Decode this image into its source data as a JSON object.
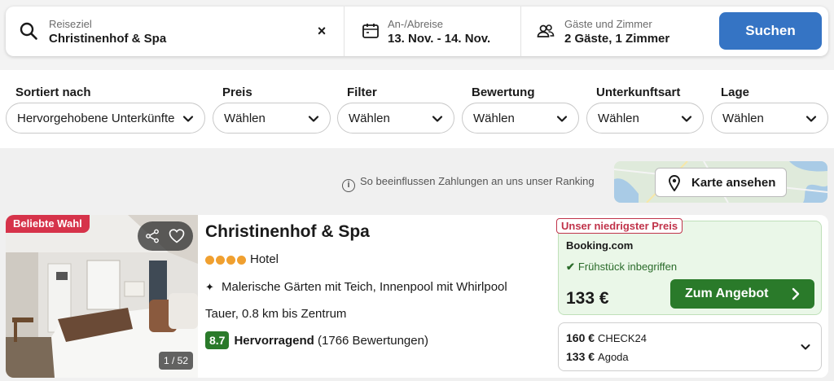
{
  "search": {
    "destination_label": "Reiseziel",
    "destination_value": "Christinenhof & Spa",
    "clear_symbol": "×",
    "dates_label": "An-/Abreise",
    "dates_value": "13. Nov. - 14. Nov.",
    "guests_label": "Gäste und Zimmer",
    "guests_value": "2 Gäste, 1 Zimmer",
    "search_button": "Suchen",
    "accent_color": "#3574c4"
  },
  "filters": [
    {
      "label": "Sortiert nach",
      "value": "Hervorgehobene Unterkünfte"
    },
    {
      "label": "Preis",
      "value": "Wählen"
    },
    {
      "label": "Filter",
      "value": "Wählen"
    },
    {
      "label": "Bewertung",
      "value": "Wählen"
    },
    {
      "label": "Unterkunftsart",
      "value": "Wählen"
    },
    {
      "label": "Lage",
      "value": "Wählen"
    }
  ],
  "ranking": {
    "info_symbol": "i",
    "text": "So beeinflussen Zahlungen an uns unser Ranking"
  },
  "map": {
    "button_label": "Karte ansehen"
  },
  "hotel": {
    "badge": "Beliebte Wahl",
    "photo_count": "1 / 52",
    "name": "Christinenhof & Spa",
    "stars": 4,
    "type": "Hotel",
    "feature_symbol": "✦",
    "feature": "Malerische Gärten mit Teich, Innenpool mit Whirlpool",
    "location": "Tauer, 0.8 km bis Zentrum",
    "rating_score": "8.7",
    "rating_word": "Hervorragend",
    "rating_count": "(1766 Bewertungen)",
    "lowest_price_badge": "Unser niedrigster Preis",
    "provider": "Booking.com",
    "breakfast_check": "✔",
    "breakfast": "Frühstück inbegriffen",
    "price": "133 €",
    "deal_button": "Zum Angebot",
    "other_offers": [
      {
        "price": "160 €",
        "provider": "CHECK24"
      },
      {
        "price": "133 €",
        "provider": "Agoda"
      }
    ],
    "colors": {
      "badge": "#d6334a",
      "stars": "#f0a030",
      "rating": "#2a7a2a",
      "deal_button": "#2a7a2a",
      "price_box": "#eaf7e8"
    }
  }
}
